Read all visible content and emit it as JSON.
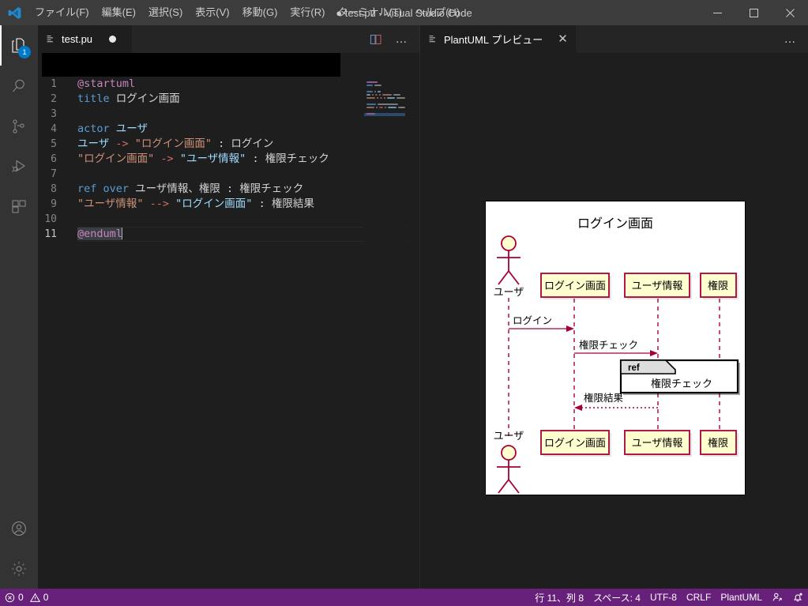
{
  "window": {
    "title": "test.pu - Visual Studio Code",
    "dirty_marker": "●",
    "minimize_label": "─",
    "maximize_label": "▢",
    "close_label": "✕"
  },
  "menubar": {
    "items": [
      {
        "name": "file",
        "label": "ファイル(F)"
      },
      {
        "name": "edit",
        "label": "編集(E)"
      },
      {
        "name": "select",
        "label": "選択(S)"
      },
      {
        "name": "view",
        "label": "表示(V)"
      },
      {
        "name": "go",
        "label": "移動(G)"
      },
      {
        "name": "run",
        "label": "実行(R)"
      },
      {
        "name": "terminal",
        "label": "ターミナル(T)"
      },
      {
        "name": "help",
        "label": "ヘルプ(H)"
      }
    ]
  },
  "activitybar": {
    "items": [
      {
        "name": "explorer",
        "icon": "files-icon",
        "badge": "1",
        "active": true
      },
      {
        "name": "search",
        "icon": "search-icon",
        "badge": "",
        "active": false
      },
      {
        "name": "scm",
        "icon": "source-control-icon",
        "badge": "",
        "active": false
      },
      {
        "name": "debug",
        "icon": "run-and-debug-icon",
        "badge": "",
        "active": false
      },
      {
        "name": "extensions",
        "icon": "extensions-icon",
        "badge": "",
        "active": false
      }
    ],
    "bottom": [
      {
        "name": "accounts",
        "icon": "account-icon"
      },
      {
        "name": "settings",
        "icon": "gear-icon"
      }
    ]
  },
  "editor_left": {
    "tab": {
      "label": "test.pu",
      "icon": "file-text-icon",
      "dirty": true
    },
    "actions": [
      {
        "name": "split-editor-right",
        "icon": "split-editor-icon"
      },
      {
        "name": "more-actions",
        "icon": "ellipsis-icon",
        "label": "…"
      }
    ],
    "code": {
      "lines": [
        {
          "n": "1",
          "tokens": [
            {
              "t": "@startuml",
              "c": "tok-pre"
            }
          ]
        },
        {
          "n": "2",
          "tokens": [
            {
              "t": "title",
              "c": "tok-key"
            },
            {
              "t": " ログイン画面",
              "c": "tok-plain"
            }
          ]
        },
        {
          "n": "3",
          "tokens": []
        },
        {
          "n": "4",
          "tokens": [
            {
              "t": "actor",
              "c": "tok-key"
            },
            {
              "t": " ",
              "c": "tok-plain"
            },
            {
              "t": "ユーザ",
              "c": "tok-id"
            }
          ]
        },
        {
          "n": "5",
          "tokens": [
            {
              "t": "ユーザ",
              "c": "tok-id"
            },
            {
              "t": " ",
              "c": "tok-plain"
            },
            {
              "t": "->",
              "c": "tok-op"
            },
            {
              "t": " ",
              "c": "tok-plain"
            },
            {
              "t": "\"ログイン画面\"",
              "c": "tok-str"
            },
            {
              "t": " : ログイン",
              "c": "tok-plain"
            }
          ]
        },
        {
          "n": "6",
          "tokens": [
            {
              "t": "\"ログイン画面\"",
              "c": "tok-str"
            },
            {
              "t": " ",
              "c": "tok-plain"
            },
            {
              "t": "->",
              "c": "tok-op"
            },
            {
              "t": " ",
              "c": "tok-plain"
            },
            {
              "t": "\"ユーザ情報\"",
              "c": "tok-id"
            },
            {
              "t": " : 権限チェック",
              "c": "tok-plain"
            }
          ]
        },
        {
          "n": "7",
          "tokens": []
        },
        {
          "n": "8",
          "tokens": [
            {
              "t": "ref over",
              "c": "tok-key"
            },
            {
              "t": " ユーザ情報、権限 : 権限チェック",
              "c": "tok-plain"
            }
          ]
        },
        {
          "n": "9",
          "tokens": [
            {
              "t": "\"ユーザ情報\"",
              "c": "tok-str"
            },
            {
              "t": " ",
              "c": "tok-plain"
            },
            {
              "t": "-->",
              "c": "tok-op"
            },
            {
              "t": " ",
              "c": "tok-plain"
            },
            {
              "t": "\"ログイン画面\"",
              "c": "tok-id"
            },
            {
              "t": " : 権限結果",
              "c": "tok-plain"
            }
          ]
        },
        {
          "n": "10",
          "tokens": []
        },
        {
          "n": "11",
          "tokens": [
            {
              "t": "@enduml",
              "c": "tok-pre"
            }
          ],
          "current": true,
          "caret": true
        }
      ]
    }
  },
  "editor_right": {
    "tab": {
      "label": "PlantUML プレビュー",
      "icon": "file-text-icon",
      "close_label": "✕"
    },
    "actions": [
      {
        "name": "more-actions",
        "icon": "ellipsis-icon",
        "label": "…"
      }
    ]
  },
  "diagram": {
    "type": "uml-sequence",
    "title": "ログイン画面",
    "colors": {
      "participant_fill": "#fefece",
      "participant_border": "#a80036",
      "arrow": "#a80036",
      "lifeline": "#a80036",
      "actor": "#a80036",
      "text": "#000000",
      "background": "#ffffff",
      "ref_fill": "#ffffff",
      "ref_border": "#000000"
    },
    "actors": [
      {
        "name": "actor-user-top",
        "label": "ユーザ"
      },
      {
        "name": "actor-user-bottom",
        "label": "ユーザ"
      }
    ],
    "participants": [
      {
        "name": "participant-login-screen",
        "label": "ログイン画面"
      },
      {
        "name": "participant-user-info",
        "label": "ユーザ情報"
      },
      {
        "name": "participant-authority",
        "label": "権限"
      }
    ],
    "messages": [
      {
        "name": "message-login",
        "label": "ログイン",
        "style": "solid"
      },
      {
        "name": "message-auth-check",
        "label": "権限チェック",
        "style": "solid"
      },
      {
        "name": "message-auth-result",
        "label": "権限結果",
        "style": "dotted"
      }
    ],
    "ref_fragment": {
      "name": "ref-fragment",
      "tag": "ref",
      "label": "権限チェック"
    }
  },
  "statusbar": {
    "left": [
      {
        "name": "problems-errors",
        "icon": "error-icon",
        "label": "0"
      },
      {
        "name": "problems-warnings",
        "icon": "warning-icon",
        "label": "0"
      }
    ],
    "right": [
      {
        "name": "editor-position",
        "label": "行 11、列 8"
      },
      {
        "name": "editor-indent",
        "label": "スペース: 4"
      },
      {
        "name": "editor-encoding",
        "label": "UTF-8"
      },
      {
        "name": "editor-eol",
        "label": "CRLF"
      },
      {
        "name": "editor-language",
        "label": "PlantUML"
      },
      {
        "name": "live-share",
        "icon": "live-share-icon",
        "label": ""
      },
      {
        "name": "notifications",
        "icon": "bell-dot-icon",
        "label": ""
      }
    ]
  }
}
